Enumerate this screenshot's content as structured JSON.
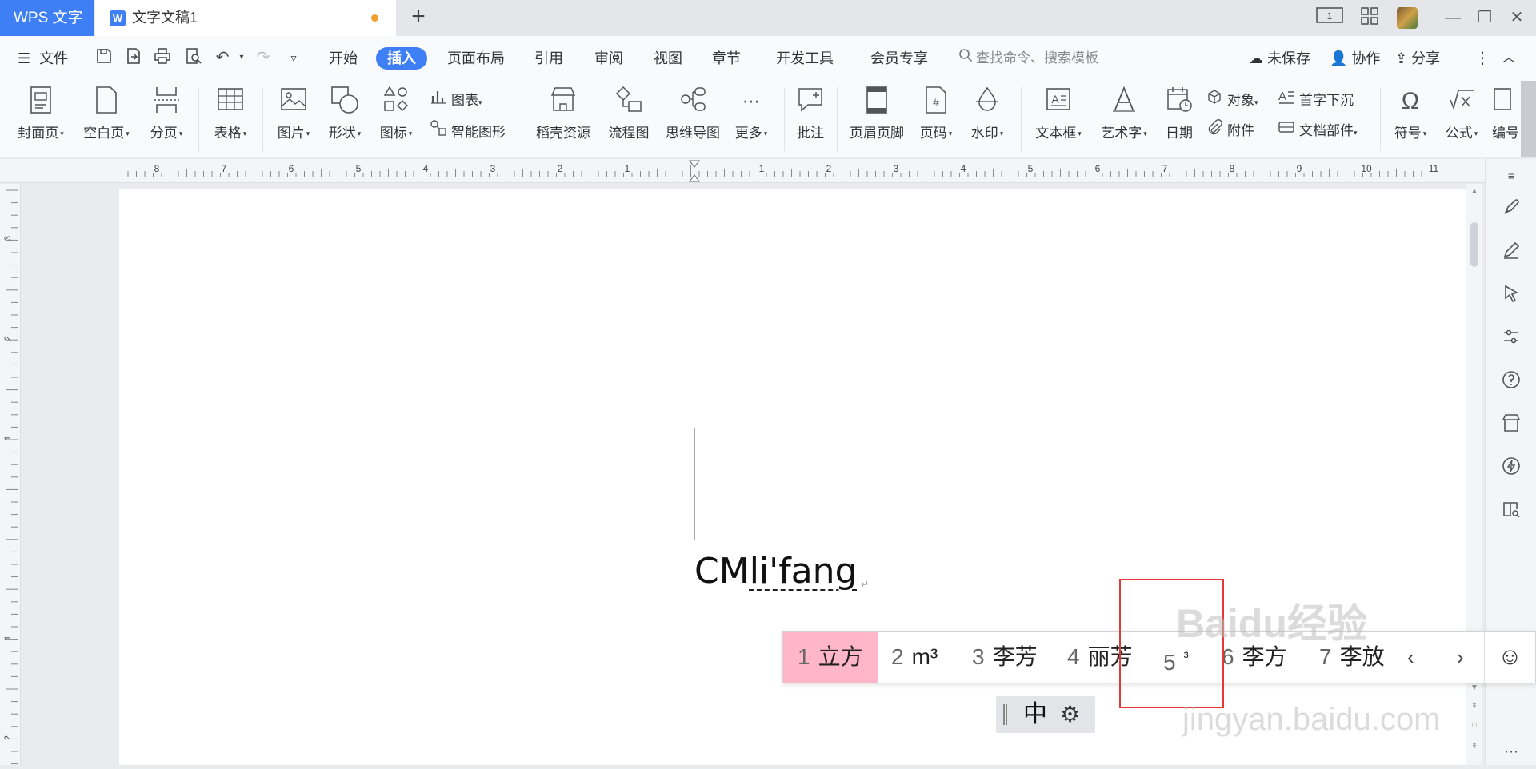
{
  "titlebar": {
    "app_tab": "WPS 文字",
    "doc_tab": "文字文稿1",
    "doc_logo": "W",
    "new_tab": "+",
    "page_count": "1",
    "controls": {
      "minimize": "—",
      "restore": "❐",
      "close": "✕"
    }
  },
  "menubar": {
    "file": "文件",
    "tabs": [
      "开始",
      "插入",
      "页面布局",
      "引用",
      "审阅",
      "视图",
      "章节",
      "开发工具",
      "会员专享"
    ],
    "active_tab": "插入",
    "search_placeholder": "查找命令、搜索模板",
    "actions": {
      "unsaved": "未保存",
      "collab": "协作",
      "share": "分享"
    }
  },
  "ribbon": {
    "cover": "封面页",
    "blank": "空白页",
    "page_break": "分页",
    "table": "表格",
    "picture": "图片",
    "shape": "形状",
    "icon": "图标",
    "chart": "图表",
    "smart_art": "智能图形",
    "resources": "稻壳资源",
    "flowchart": "流程图",
    "mindmap": "思维导图",
    "more": "更多",
    "comment": "批注",
    "header_footer": "页眉页脚",
    "page_number": "页码",
    "watermark": "水印",
    "textbox": "文本框",
    "wordart": "艺术字",
    "date": "日期",
    "object": "对象",
    "attachment": "附件",
    "dropcap": "首字下沉",
    "doc_parts": "文档部件",
    "symbol": "符号",
    "formula": "公式",
    "edit": "编号"
  },
  "ruler": {
    "h_labels_left": [
      "8",
      "7",
      "6",
      "5",
      "4",
      "3",
      "2",
      "1"
    ],
    "h_labels_right": [
      "1",
      "2",
      "3",
      "4",
      "5",
      "6",
      "7",
      "8",
      "9",
      "10",
      "11"
    ],
    "v_labels": [
      "3",
      "2",
      "1",
      "1",
      "2"
    ]
  },
  "document": {
    "text_plain": "CM",
    "text_pinyin": "li'fang",
    "para_mark": "↵"
  },
  "ime": {
    "candidates": [
      {
        "num": "1",
        "text": "立方"
      },
      {
        "num": "2",
        "text": "m³"
      },
      {
        "num": "3",
        "text": "李芳"
      },
      {
        "num": "4",
        "text": "丽芳"
      },
      {
        "num": "5",
        "text": "³"
      },
      {
        "num": "6",
        "text": "李方"
      },
      {
        "num": "7",
        "text": "李放"
      }
    ],
    "selected_index": 0,
    "prev": "‹",
    "next": "›",
    "emoji": "☺",
    "mode": "中",
    "settings": "⚙"
  },
  "watermark": {
    "brand": "Baidu经验",
    "url": "jingyan.baidu.com"
  }
}
